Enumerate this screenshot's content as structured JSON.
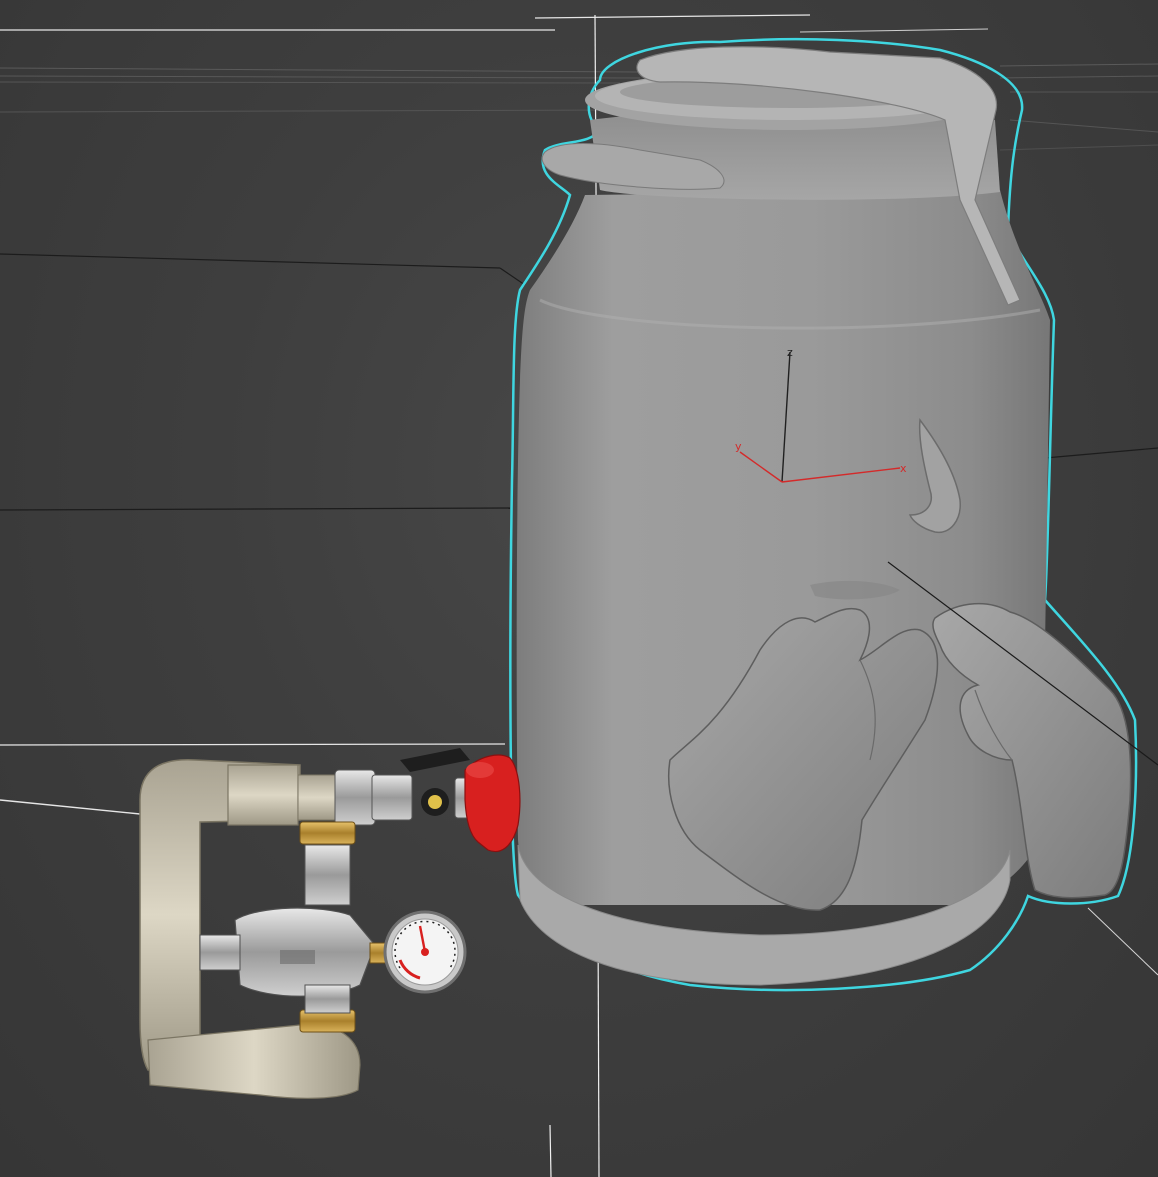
{
  "viewport": {
    "background_color": "#3e3e3e",
    "grid_line_color": "#1c1c1c",
    "highlight_line_color": "#e6e6e6"
  },
  "selection": {
    "object_name": "milk-can-mesh",
    "outline_color": "#3fd6e0",
    "mesh_color": "#9a9a9a"
  },
  "gizmo": {
    "axes": [
      {
        "name": "x",
        "label": "x",
        "color": "#d42a2a"
      },
      {
        "name": "y",
        "label": "y",
        "color": "#d42a2a"
      },
      {
        "name": "z",
        "label": "z",
        "color": "#202020"
      }
    ]
  },
  "valve_assembly": {
    "handle_color": "#d8201f",
    "gauge_icon": "pressure-gauge-icon",
    "pipe_color": "#cfc8b4",
    "brass_color": "#c79a3a",
    "steel_color": "#b8b8b8"
  }
}
